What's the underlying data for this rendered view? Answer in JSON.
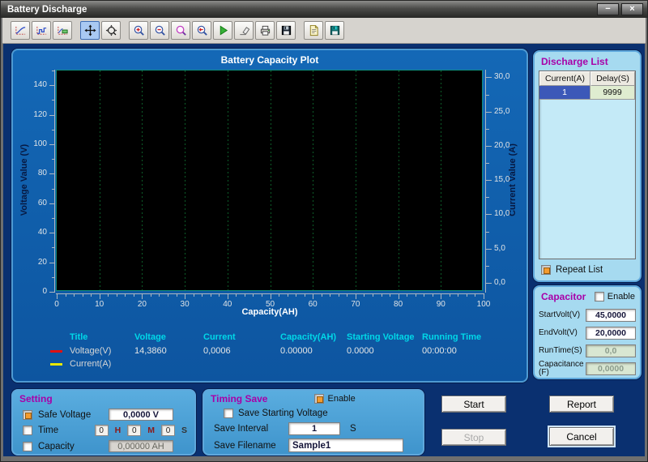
{
  "window": {
    "title": "Battery Discharge",
    "minimize_glyph": "−",
    "close_glyph": "×"
  },
  "toolbar": {
    "groups": [
      [
        {
          "name": "curve-plot",
          "icon": "plot-curve"
        },
        {
          "name": "step-plot",
          "icon": "plot-step"
        },
        {
          "name": "legend-plot",
          "icon": "plot-legend"
        }
      ],
      [
        {
          "name": "pan",
          "icon": "pan",
          "active": true
        },
        {
          "name": "zoom-tool",
          "icon": "zoom-drag"
        }
      ],
      [
        {
          "name": "zoom-in",
          "icon": "zoom-in"
        },
        {
          "name": "zoom-out",
          "icon": "zoom-out"
        },
        {
          "name": "zoom-window",
          "icon": "zoom-window"
        },
        {
          "name": "zoom-reset",
          "icon": "zoom-back"
        },
        {
          "name": "run",
          "icon": "run"
        },
        {
          "name": "erase",
          "icon": "erase"
        },
        {
          "name": "print",
          "icon": "print"
        },
        {
          "name": "save",
          "icon": "save"
        }
      ],
      [
        {
          "name": "report-file",
          "icon": "report-doc"
        },
        {
          "name": "save-data",
          "icon": "save-data"
        }
      ]
    ]
  },
  "chart_data": {
    "type": "line",
    "title": "Battery Capacity Plot",
    "xlabel": "Capacity(AH)",
    "ylabel_left": "Voltage Value (V)",
    "ylabel_right": "Current Value (A)",
    "x_axis": {
      "min": 0,
      "max": 100,
      "major_step": 10,
      "minor_step": 2,
      "tick_labels": [
        "0",
        "10",
        "20",
        "30",
        "40",
        "50",
        "60",
        "70",
        "80",
        "90",
        "100"
      ]
    },
    "y_left_axis": {
      "min": 0,
      "max": 150,
      "major_step": 20,
      "minor_step": 10,
      "tick_labels": [
        "0",
        "20",
        "40",
        "60",
        "80",
        "100",
        "120",
        "140"
      ]
    },
    "y_right_axis": {
      "display_min": -1.3,
      "display_max": 31,
      "major_step": 5,
      "minor_step": 2.5,
      "tick_values": [
        0,
        5,
        10,
        15,
        20,
        25,
        30
      ],
      "tick_labels": [
        "0,0",
        "5,0",
        "10,0",
        "15,0",
        "20,0",
        "25,0",
        "30,0"
      ]
    },
    "grid": {
      "vertical_dotted": true,
      "color": "#0c5c28"
    },
    "plot_bg": "#000000",
    "series": [
      {
        "name": "Voltage(V)",
        "color": "#e01010",
        "values": []
      },
      {
        "name": "Current(A)",
        "color": "#e8e800",
        "values": []
      }
    ]
  },
  "legend": {
    "headers": [
      "Title",
      "Voltage",
      "Current",
      "Capacity(AH)",
      "Starting Voltage",
      "Running Time"
    ],
    "readouts": [
      "14,3860",
      "0,0006",
      "0.00000",
      "0.0000",
      "00:00:00"
    ],
    "series": [
      {
        "name": "Voltage(V)",
        "color": "#e01010"
      },
      {
        "name": "Current(A)",
        "color": "#e8e800"
      }
    ]
  },
  "discharge_list": {
    "title": "Discharge List",
    "columns": [
      "Current(A)",
      "Delay(S)"
    ],
    "rows": [
      [
        "1",
        "9999"
      ]
    ],
    "repeat": {
      "label": "Repeat List",
      "checked": true
    }
  },
  "capacitor": {
    "title": "Capacitor",
    "enable": {
      "label": "Enable",
      "checked": false
    },
    "fields": [
      {
        "name": "start-volt",
        "label": "StartVolt(V)",
        "value": "45,0000",
        "disabled": false
      },
      {
        "name": "end-volt",
        "label": "EndVolt(V)",
        "value": "20,0000",
        "disabled": false
      },
      {
        "name": "run-time",
        "label": "RunTime(S)",
        "value": "0,0",
        "disabled": true
      },
      {
        "name": "capacitance",
        "label": "Capacitance",
        "label2": "(F)",
        "value": "0,0000",
        "disabled": true
      }
    ]
  },
  "setting": {
    "title": "Setting",
    "rows": [
      {
        "name": "safe-voltage",
        "label": "Safe Voltage",
        "checked": true,
        "value": "0,0000 V",
        "disabled": false
      },
      {
        "name": "time",
        "label": "Time",
        "checked": false,
        "time": {
          "boxes": [
            "0",
            "0",
            "0"
          ],
          "letters": [
            "H",
            "M",
            "S"
          ]
        }
      },
      {
        "name": "capacity",
        "label": "Capacity",
        "checked": false,
        "value": "0,00000 AH",
        "disabled": true
      }
    ]
  },
  "timing_save": {
    "title": "Timing Save",
    "enable": {
      "label": "Enable",
      "checked": true
    },
    "save_starting": {
      "label": "Save Starting Voltage",
      "checked": false
    },
    "interval": {
      "label": "Save Interval",
      "value": "1",
      "unit": "S"
    },
    "filename": {
      "label": "Save Filename",
      "value": "Sample1"
    }
  },
  "actions": {
    "start": "Start",
    "report": "Report",
    "stop": "Stop",
    "cancel": "Cancel",
    "stop_disabled": true
  }
}
